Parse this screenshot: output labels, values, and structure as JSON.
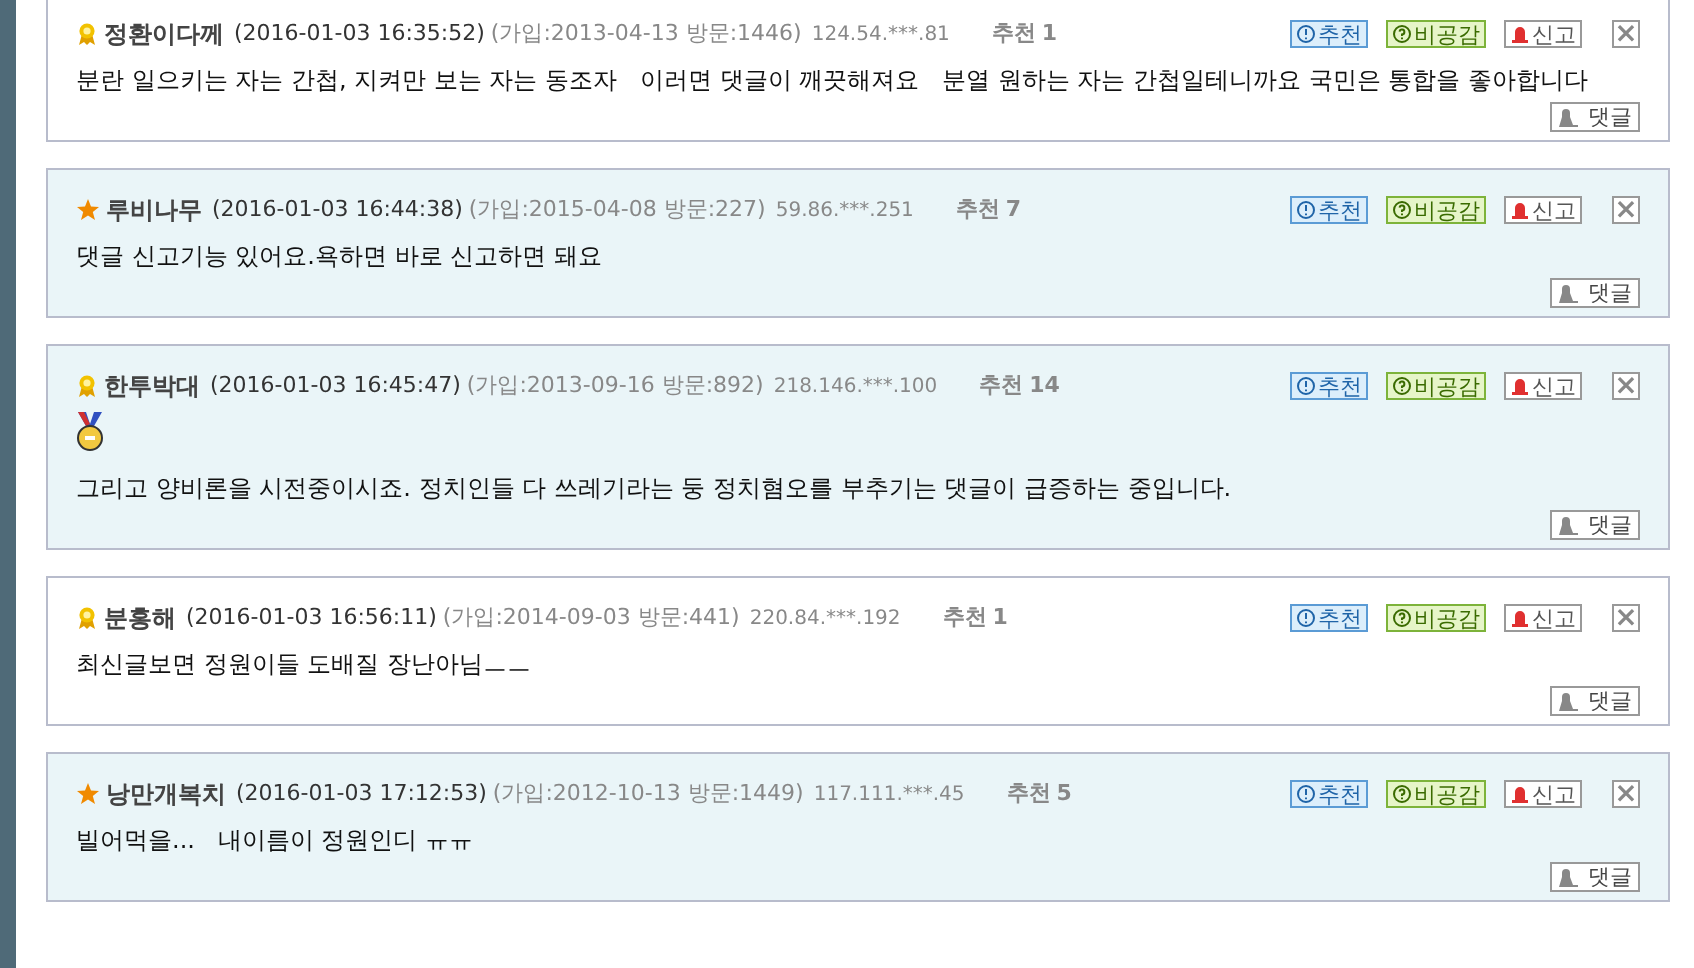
{
  "comments": [
    {
      "kind": "ribbon",
      "highlighted": false,
      "medal": false,
      "name": "정환이다께",
      "date": "(2016-01-03 16:35:52)",
      "join": "(가입:2013-04-13 방문:1446)",
      "ip": "124.54.***.81",
      "likes_label": "추천",
      "likes": "1",
      "actions": [
        "추천",
        "비공감",
        "신고"
      ],
      "close": "×",
      "body": "분란 일으키는 자는 간첩, 지켜만 보는 자는 동조자   이러면 댓글이 깨끗해져요   분열 원하는 자는 간첩일테니까요 국민은 통합을 좋아합니다",
      "reply": "댓글"
    },
    {
      "kind": "star",
      "highlighted": true,
      "medal": false,
      "name": "루비나무",
      "date": "(2016-01-03 16:44:38)",
      "join": "(가입:2015-04-08 방문:227)",
      "ip": "59.86.***.251",
      "likes_label": "추천",
      "likes": "7",
      "actions": [
        "추천",
        "비공감",
        "신고"
      ],
      "close": "×",
      "body": "댓글 신고기능 있어요.욕하면 바로 신고하면 돼요",
      "reply": "댓글"
    },
    {
      "kind": "ribbon",
      "highlighted": true,
      "medal": true,
      "name": "한투박대",
      "date": "(2016-01-03 16:45:47)",
      "join": "(가입:2013-09-16 방문:892)",
      "ip": "218.146.***.100",
      "likes_label": "추천",
      "likes": "14",
      "actions": [
        "추천",
        "비공감",
        "신고"
      ],
      "close": "×",
      "body": "그리고 양비론을 시전중이시죠. 정치인들 다 쓰레기라는 둥 정치혐오를 부추기는 댓글이 급증하는 중입니다.",
      "reply": "댓글"
    },
    {
      "kind": "ribbon",
      "highlighted": false,
      "medal": false,
      "name": "분홍해",
      "date": "(2016-01-03 16:56:11)",
      "join": "(가입:2014-09-03 방문:441)",
      "ip": "220.84.***.192",
      "likes_label": "추천",
      "likes": "1",
      "actions": [
        "추천",
        "비공감",
        "신고"
      ],
      "close": "×",
      "body": "최신글보면 정원이들 도배질 장난아님ㅡㅡ",
      "reply": "댓글"
    },
    {
      "kind": "star",
      "highlighted": true,
      "medal": false,
      "name": "낭만개복치",
      "date": "(2016-01-03 17:12:53)",
      "join": "(가입:2012-10-13 방문:1449)",
      "ip": "117.111.***.45",
      "likes_label": "추천",
      "likes": "5",
      "actions": [
        "추천",
        "비공감",
        "신고"
      ],
      "close": "×",
      "body": "빌어먹을...   내이름이 정원인디 ㅠㅠ",
      "reply": "댓글"
    }
  ]
}
